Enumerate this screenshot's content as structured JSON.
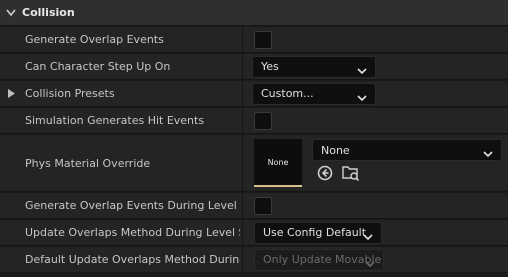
{
  "section": {
    "title": "Collision",
    "chevron_icon": "chevron-down-icon"
  },
  "rows": {
    "generate_overlap": {
      "label": "Generate Overlap Events",
      "checked": false
    },
    "step_up": {
      "label": "Can Character Step Up On",
      "value": "Yes"
    },
    "presets": {
      "label": "Collision Presets",
      "value": "Custom...",
      "expander_icon": "triangle-right-icon"
    },
    "hit_events": {
      "label": "Simulation Generates Hit Events",
      "checked": false
    },
    "phys_material": {
      "label": "Phys Material Override",
      "thumbnail_text": "None",
      "value": "None",
      "browse_back_icon": "arrow-left-circle-icon",
      "browse_icon": "browse-folder-icon"
    },
    "overlap_level_streaming": {
      "label": "Generate Overlap Events During Level Str...",
      "checked": false
    },
    "update_overlaps_method": {
      "label": "Update Overlaps Method During Level Str...",
      "value": "Use Config Default"
    },
    "default_update_overlaps": {
      "label": "Default Update Overlaps Method During L...",
      "value": "Only Update Movable"
    }
  },
  "colors": {
    "accent": "#d3c08b",
    "background": "#1a1a1a",
    "row": "#242424",
    "header": "#2f2f2f"
  }
}
